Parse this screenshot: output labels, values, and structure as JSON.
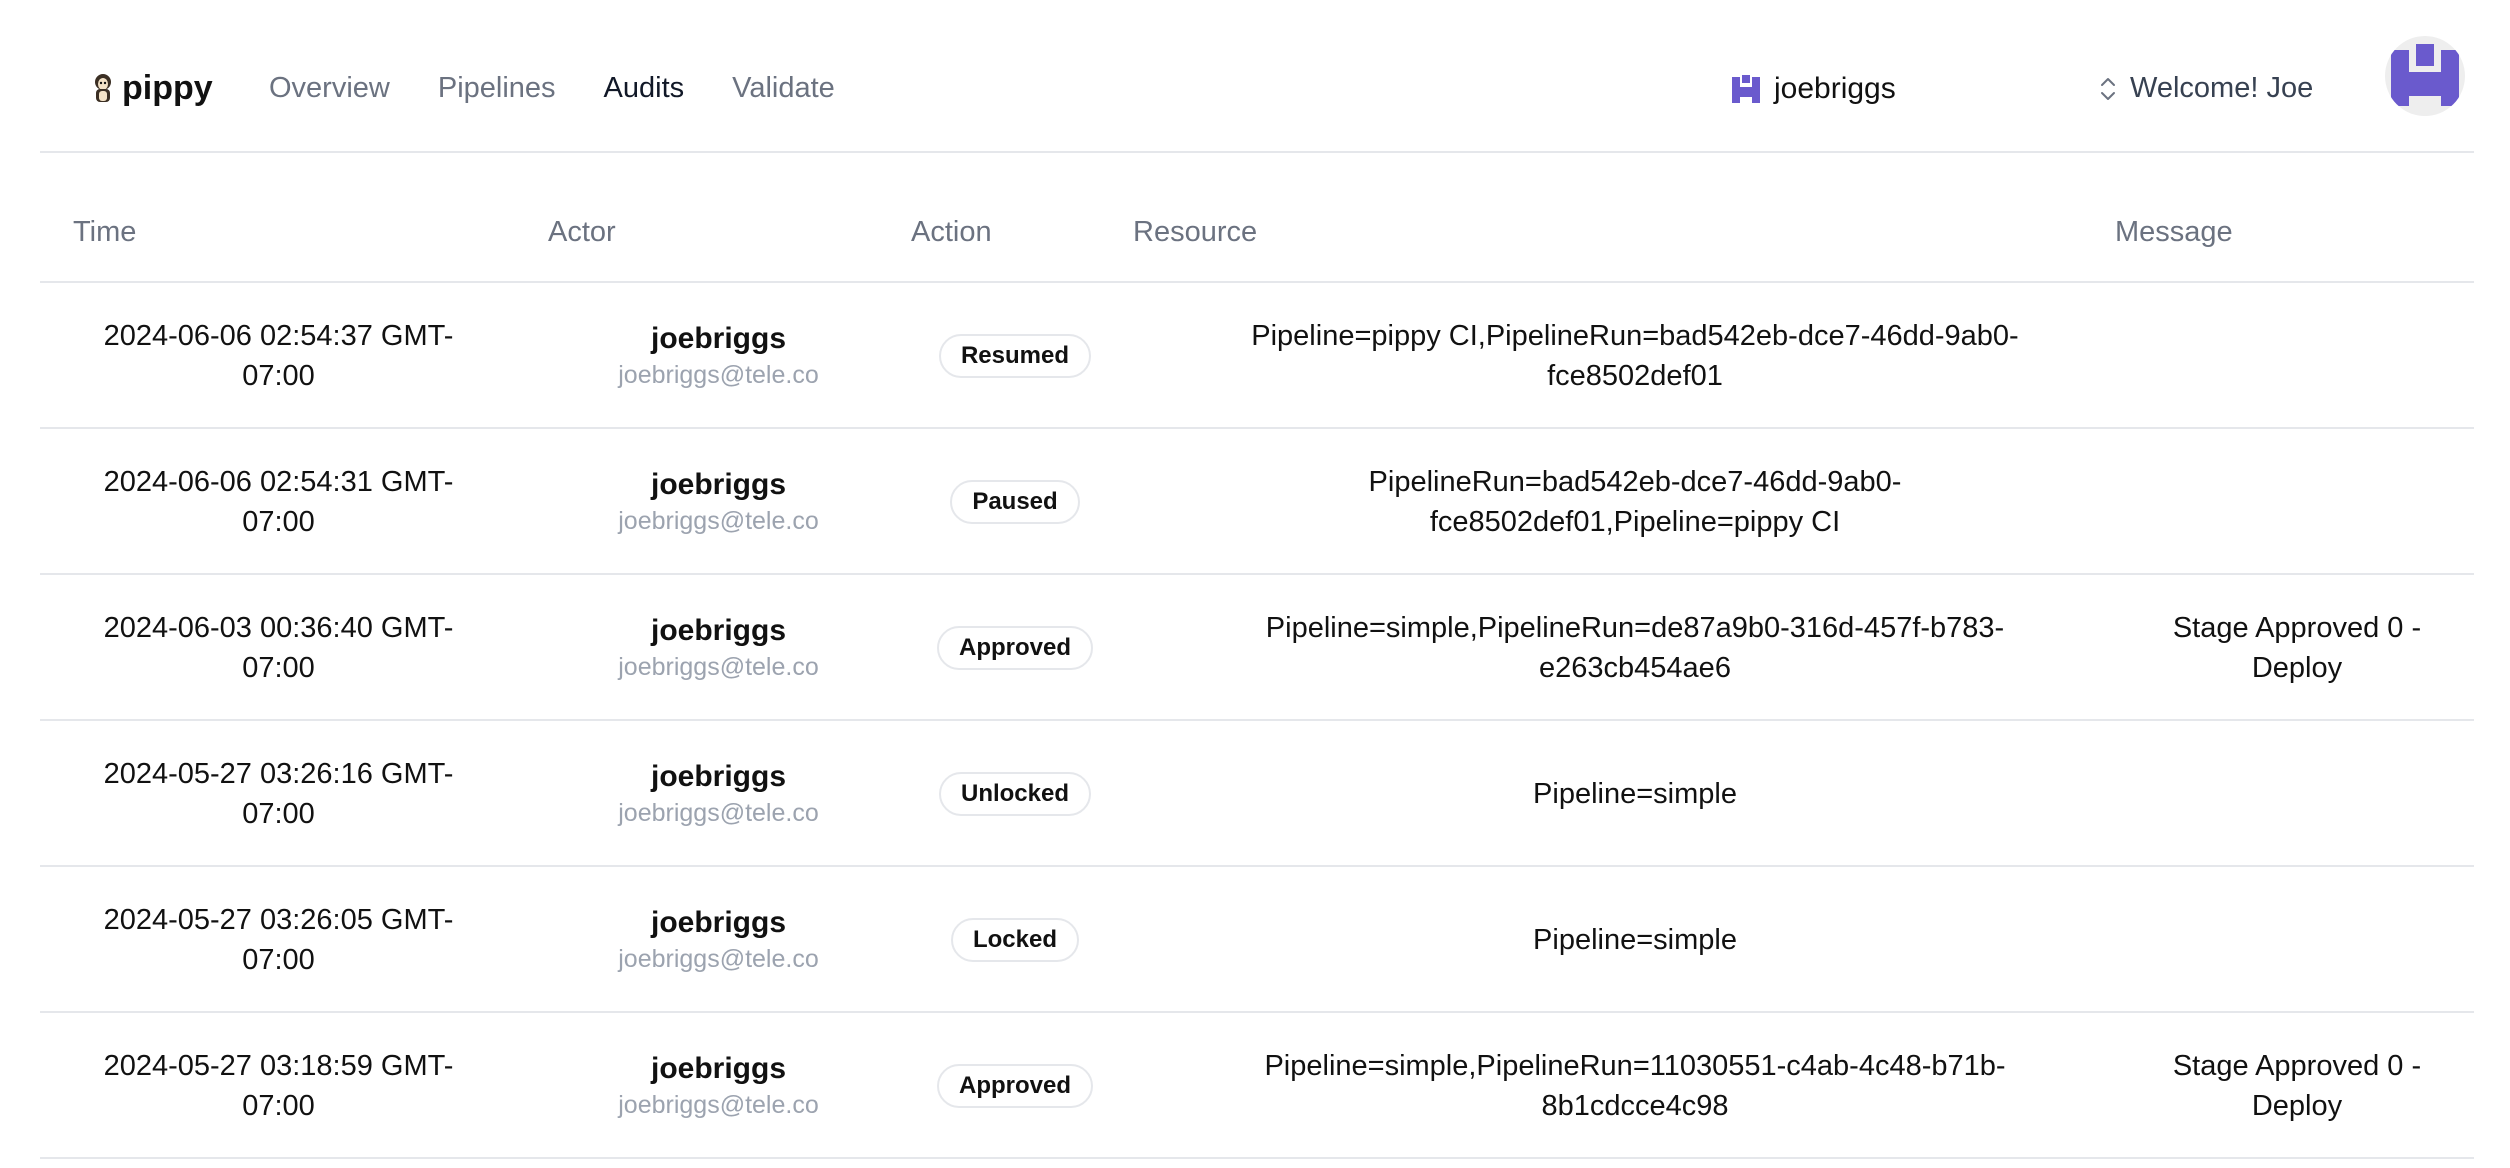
{
  "app": {
    "brand": "pippy",
    "nav": [
      {
        "label": "Overview",
        "active": false
      },
      {
        "label": "Pipelines",
        "active": false
      },
      {
        "label": "Audits",
        "active": true
      },
      {
        "label": "Validate",
        "active": false
      }
    ],
    "workspace": {
      "name": "joebriggs",
      "icon": "workspace-avatar-icon"
    },
    "welcome": "Welcome! Joe",
    "accent_color": "#6a5acd"
  },
  "table": {
    "headers": {
      "time": "Time",
      "actor": "Actor",
      "action": "Action",
      "resource": "Resource",
      "message": "Message"
    },
    "rows": [
      {
        "time": [
          "2024-06-06 02:54:37 GMT-",
          "07:00"
        ],
        "actor_name": "joebriggs",
        "actor_email": "joebriggs@tele.co",
        "action": "Resumed",
        "resource": [
          "Pipeline=pippy CI,PipelineRun=bad542eb-dce7-46dd-9ab0-",
          "fce8502def01"
        ],
        "message": [
          "",
          ""
        ]
      },
      {
        "time": [
          "2024-06-06 02:54:31 GMT-",
          "07:00"
        ],
        "actor_name": "joebriggs",
        "actor_email": "joebriggs@tele.co",
        "action": "Paused",
        "resource": [
          "PipelineRun=bad542eb-dce7-46dd-9ab0-",
          "fce8502def01,Pipeline=pippy CI"
        ],
        "message": [
          "",
          ""
        ]
      },
      {
        "time": [
          "2024-06-03 00:36:40 GMT-",
          "07:00"
        ],
        "actor_name": "joebriggs",
        "actor_email": "joebriggs@tele.co",
        "action": "Approved",
        "resource": [
          "Pipeline=simple,PipelineRun=de87a9b0-316d-457f-b783-",
          "e263cb454ae6"
        ],
        "message": [
          "Stage Approved 0 -",
          "Deploy"
        ]
      },
      {
        "time": [
          "2024-05-27 03:26:16 GMT-",
          "07:00"
        ],
        "actor_name": "joebriggs",
        "actor_email": "joebriggs@tele.co",
        "action": "Unlocked",
        "resource": [
          "Pipeline=simple",
          ""
        ],
        "message": [
          "",
          ""
        ]
      },
      {
        "time": [
          "2024-05-27 03:26:05 GMT-",
          "07:00"
        ],
        "actor_name": "joebriggs",
        "actor_email": "joebriggs@tele.co",
        "action": "Locked",
        "resource": [
          "Pipeline=simple",
          ""
        ],
        "message": [
          "",
          ""
        ]
      },
      {
        "time": [
          "2024-05-27 03:18:59 GMT-",
          "07:00"
        ],
        "actor_name": "joebriggs",
        "actor_email": "joebriggs@tele.co",
        "action": "Approved",
        "resource": [
          "Pipeline=simple,PipelineRun=11030551-c4ab-4c48-b71b-",
          "8b1cdcce4c98"
        ],
        "message": [
          "Stage Approved 0 -",
          "Deploy"
        ]
      }
    ]
  }
}
